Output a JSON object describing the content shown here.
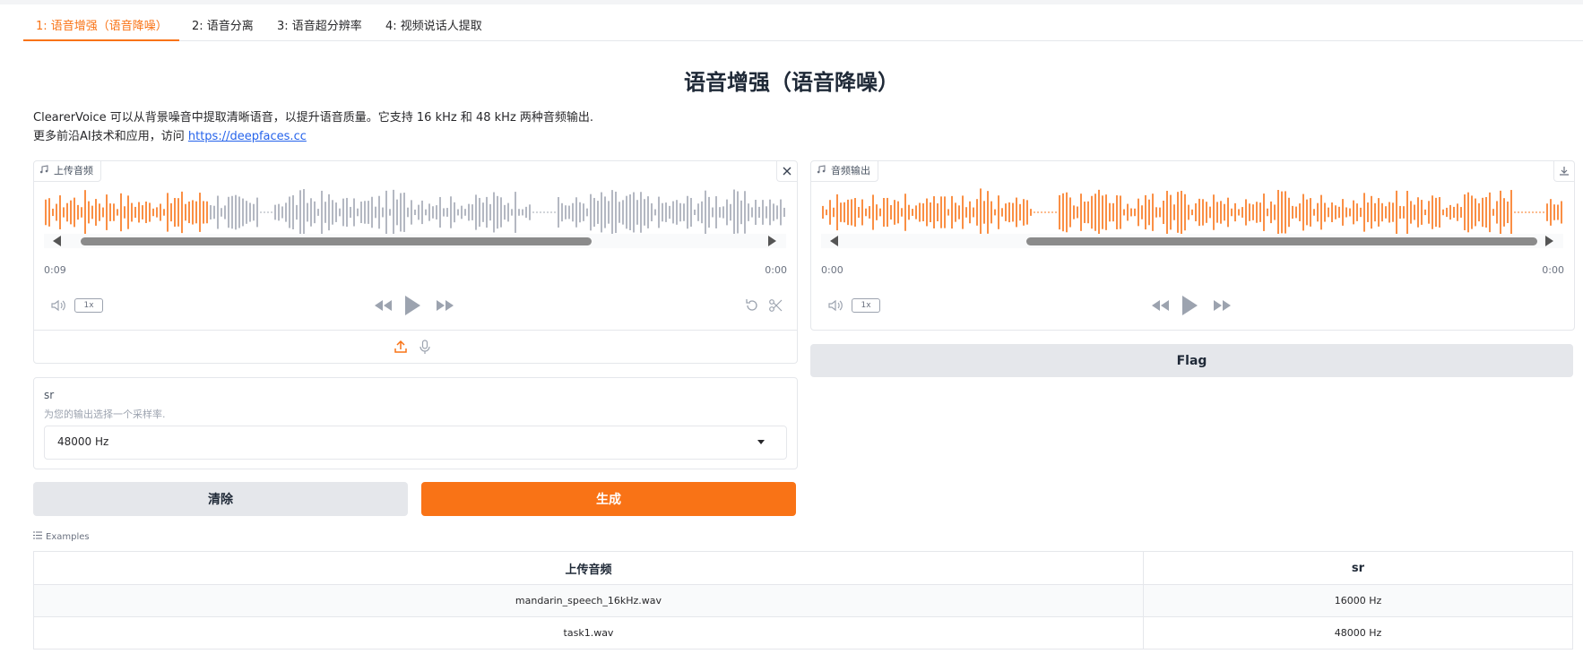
{
  "tabs": [
    {
      "label": "1: 语音增强（语音降噪）",
      "active": true
    },
    {
      "label": "2: 语音分离",
      "active": false
    },
    {
      "label": "3: 语音超分辨率",
      "active": false
    },
    {
      "label": "4: 视频说话人提取",
      "active": false
    }
  ],
  "page": {
    "title": "语音增强（语音降噪）",
    "desc_line1": "ClearerVoice 可以从背景噪音中提取清晰语音，以提升语音质量。它支持 16 kHz 和 48 kHz 两种音频输出.",
    "desc_line2_prefix": "更多前沿AI技术和应用，访问 ",
    "desc_link": "https://deepfaces.cc"
  },
  "input_audio": {
    "label": "上传音频",
    "time_current": "0:09",
    "time_end": "0:00",
    "playback_rate": "1x",
    "played_fraction": 0.22,
    "icons": [
      "music-icon",
      "close-icon",
      "volume-icon",
      "rewind-icon",
      "play-icon",
      "forward-icon",
      "undo-icon",
      "scissors-icon",
      "upload-icon",
      "microphone-icon"
    ]
  },
  "output_audio": {
    "label": "音频输出",
    "time_current": "0:00",
    "time_end": "0:00",
    "playback_rate": "1x",
    "played_fraction": 1.0,
    "icons": [
      "music-icon",
      "download-icon",
      "volume-icon",
      "rewind-icon",
      "play-icon",
      "forward-icon"
    ]
  },
  "sr": {
    "label": "sr",
    "info": "为您的输出选择一个采样率.",
    "value": "48000 Hz"
  },
  "buttons": {
    "clear": "清除",
    "generate": "生成",
    "flag": "Flag"
  },
  "examples": {
    "label": "Examples",
    "headers": [
      "上传音频",
      "sr"
    ],
    "rows": [
      [
        "mandarin_speech_16kHz.wav",
        "16000 Hz"
      ],
      [
        "task1.wav",
        "48000 Hz"
      ]
    ]
  },
  "colors": {
    "accent": "#f97316",
    "wave_unplayed": "#a1a7b3",
    "border": "#e5e7eb"
  }
}
